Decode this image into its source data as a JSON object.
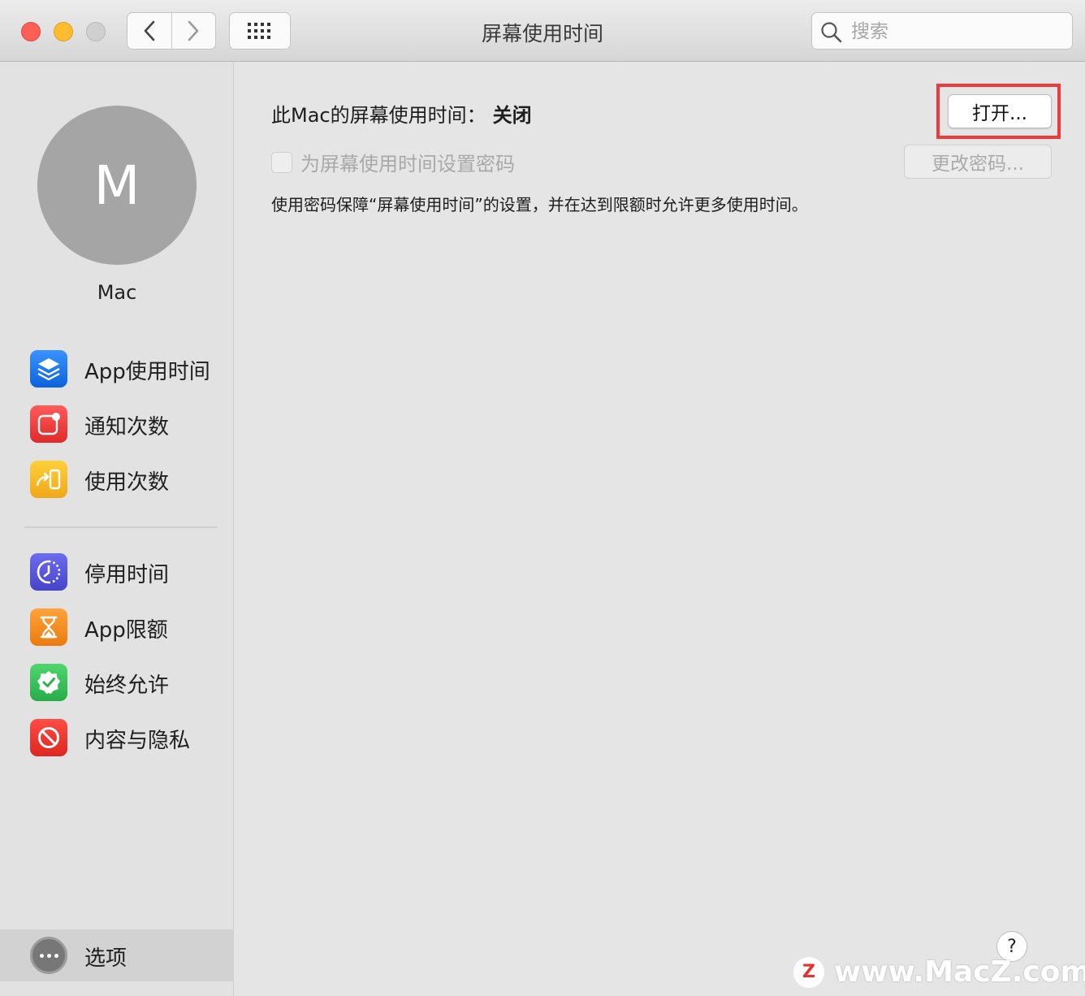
{
  "window": {
    "title": "屏幕使用时间",
    "search_placeholder": "搜索"
  },
  "sidebar": {
    "avatar_initial": "M",
    "user_name": "Mac",
    "items": [
      {
        "label": "App使用时间",
        "icon": "layers-icon",
        "color": "#1a75f0"
      },
      {
        "label": "通知次数",
        "icon": "notification-icon",
        "color": "#ee3b3b"
      },
      {
        "label": "使用次数",
        "icon": "pickup-icon",
        "color": "#f2b21c"
      },
      {
        "label": "停用时间",
        "icon": "downtime-icon",
        "color": "#5856d6"
      },
      {
        "label": "App限额",
        "icon": "hourglass-icon",
        "color": "#f08c1c"
      },
      {
        "label": "始终允许",
        "icon": "checkmark-badge-icon",
        "color": "#34c759"
      },
      {
        "label": "内容与隐私",
        "icon": "restriction-icon",
        "color": "#e8302a"
      }
    ],
    "options_label": "选项"
  },
  "main": {
    "status_prefix": "此Mac的屏幕使用时间：",
    "status_value": "关闭",
    "open_button": "打开...",
    "passcode_checkbox": "为屏幕使用时间设置密码",
    "change_passcode_button": "更改密码...",
    "description": "使用密码保障“屏幕使用时间”的设置，并在达到限额时允许更多使用时间。",
    "help_label": "?"
  },
  "watermark": {
    "logo_letter": "Z",
    "text": "www.MacZ.com"
  }
}
